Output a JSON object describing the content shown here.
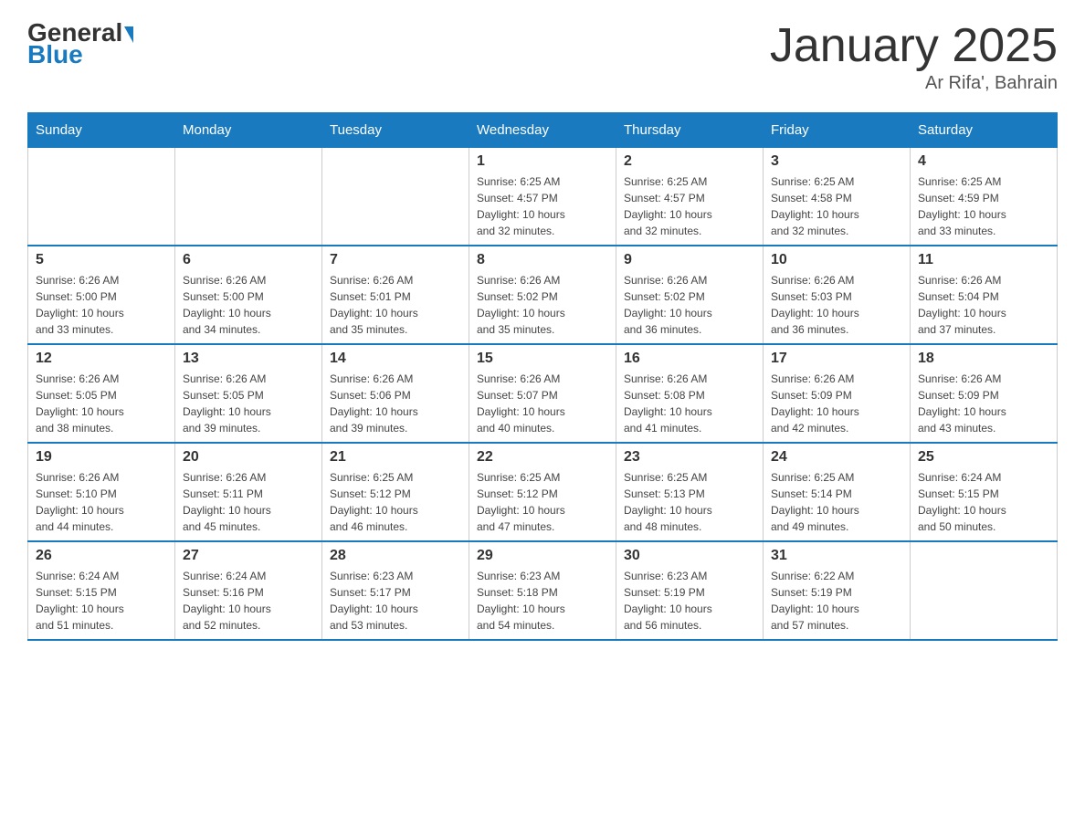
{
  "header": {
    "logo_general": "General",
    "logo_blue": "Blue",
    "month_title": "January 2025",
    "location": "Ar Rifa', Bahrain"
  },
  "days_of_week": [
    "Sunday",
    "Monday",
    "Tuesday",
    "Wednesday",
    "Thursday",
    "Friday",
    "Saturday"
  ],
  "weeks": [
    [
      {
        "day": "",
        "info": ""
      },
      {
        "day": "",
        "info": ""
      },
      {
        "day": "",
        "info": ""
      },
      {
        "day": "1",
        "info": "Sunrise: 6:25 AM\nSunset: 4:57 PM\nDaylight: 10 hours\nand 32 minutes."
      },
      {
        "day": "2",
        "info": "Sunrise: 6:25 AM\nSunset: 4:57 PM\nDaylight: 10 hours\nand 32 minutes."
      },
      {
        "day": "3",
        "info": "Sunrise: 6:25 AM\nSunset: 4:58 PM\nDaylight: 10 hours\nand 32 minutes."
      },
      {
        "day": "4",
        "info": "Sunrise: 6:25 AM\nSunset: 4:59 PM\nDaylight: 10 hours\nand 33 minutes."
      }
    ],
    [
      {
        "day": "5",
        "info": "Sunrise: 6:26 AM\nSunset: 5:00 PM\nDaylight: 10 hours\nand 33 minutes."
      },
      {
        "day": "6",
        "info": "Sunrise: 6:26 AM\nSunset: 5:00 PM\nDaylight: 10 hours\nand 34 minutes."
      },
      {
        "day": "7",
        "info": "Sunrise: 6:26 AM\nSunset: 5:01 PM\nDaylight: 10 hours\nand 35 minutes."
      },
      {
        "day": "8",
        "info": "Sunrise: 6:26 AM\nSunset: 5:02 PM\nDaylight: 10 hours\nand 35 minutes."
      },
      {
        "day": "9",
        "info": "Sunrise: 6:26 AM\nSunset: 5:02 PM\nDaylight: 10 hours\nand 36 minutes."
      },
      {
        "day": "10",
        "info": "Sunrise: 6:26 AM\nSunset: 5:03 PM\nDaylight: 10 hours\nand 36 minutes."
      },
      {
        "day": "11",
        "info": "Sunrise: 6:26 AM\nSunset: 5:04 PM\nDaylight: 10 hours\nand 37 minutes."
      }
    ],
    [
      {
        "day": "12",
        "info": "Sunrise: 6:26 AM\nSunset: 5:05 PM\nDaylight: 10 hours\nand 38 minutes."
      },
      {
        "day": "13",
        "info": "Sunrise: 6:26 AM\nSunset: 5:05 PM\nDaylight: 10 hours\nand 39 minutes."
      },
      {
        "day": "14",
        "info": "Sunrise: 6:26 AM\nSunset: 5:06 PM\nDaylight: 10 hours\nand 39 minutes."
      },
      {
        "day": "15",
        "info": "Sunrise: 6:26 AM\nSunset: 5:07 PM\nDaylight: 10 hours\nand 40 minutes."
      },
      {
        "day": "16",
        "info": "Sunrise: 6:26 AM\nSunset: 5:08 PM\nDaylight: 10 hours\nand 41 minutes."
      },
      {
        "day": "17",
        "info": "Sunrise: 6:26 AM\nSunset: 5:09 PM\nDaylight: 10 hours\nand 42 minutes."
      },
      {
        "day": "18",
        "info": "Sunrise: 6:26 AM\nSunset: 5:09 PM\nDaylight: 10 hours\nand 43 minutes."
      }
    ],
    [
      {
        "day": "19",
        "info": "Sunrise: 6:26 AM\nSunset: 5:10 PM\nDaylight: 10 hours\nand 44 minutes."
      },
      {
        "day": "20",
        "info": "Sunrise: 6:26 AM\nSunset: 5:11 PM\nDaylight: 10 hours\nand 45 minutes."
      },
      {
        "day": "21",
        "info": "Sunrise: 6:25 AM\nSunset: 5:12 PM\nDaylight: 10 hours\nand 46 minutes."
      },
      {
        "day": "22",
        "info": "Sunrise: 6:25 AM\nSunset: 5:12 PM\nDaylight: 10 hours\nand 47 minutes."
      },
      {
        "day": "23",
        "info": "Sunrise: 6:25 AM\nSunset: 5:13 PM\nDaylight: 10 hours\nand 48 minutes."
      },
      {
        "day": "24",
        "info": "Sunrise: 6:25 AM\nSunset: 5:14 PM\nDaylight: 10 hours\nand 49 minutes."
      },
      {
        "day": "25",
        "info": "Sunrise: 6:24 AM\nSunset: 5:15 PM\nDaylight: 10 hours\nand 50 minutes."
      }
    ],
    [
      {
        "day": "26",
        "info": "Sunrise: 6:24 AM\nSunset: 5:15 PM\nDaylight: 10 hours\nand 51 minutes."
      },
      {
        "day": "27",
        "info": "Sunrise: 6:24 AM\nSunset: 5:16 PM\nDaylight: 10 hours\nand 52 minutes."
      },
      {
        "day": "28",
        "info": "Sunrise: 6:23 AM\nSunset: 5:17 PM\nDaylight: 10 hours\nand 53 minutes."
      },
      {
        "day": "29",
        "info": "Sunrise: 6:23 AM\nSunset: 5:18 PM\nDaylight: 10 hours\nand 54 minutes."
      },
      {
        "day": "30",
        "info": "Sunrise: 6:23 AM\nSunset: 5:19 PM\nDaylight: 10 hours\nand 56 minutes."
      },
      {
        "day": "31",
        "info": "Sunrise: 6:22 AM\nSunset: 5:19 PM\nDaylight: 10 hours\nand 57 minutes."
      },
      {
        "day": "",
        "info": ""
      }
    ]
  ]
}
